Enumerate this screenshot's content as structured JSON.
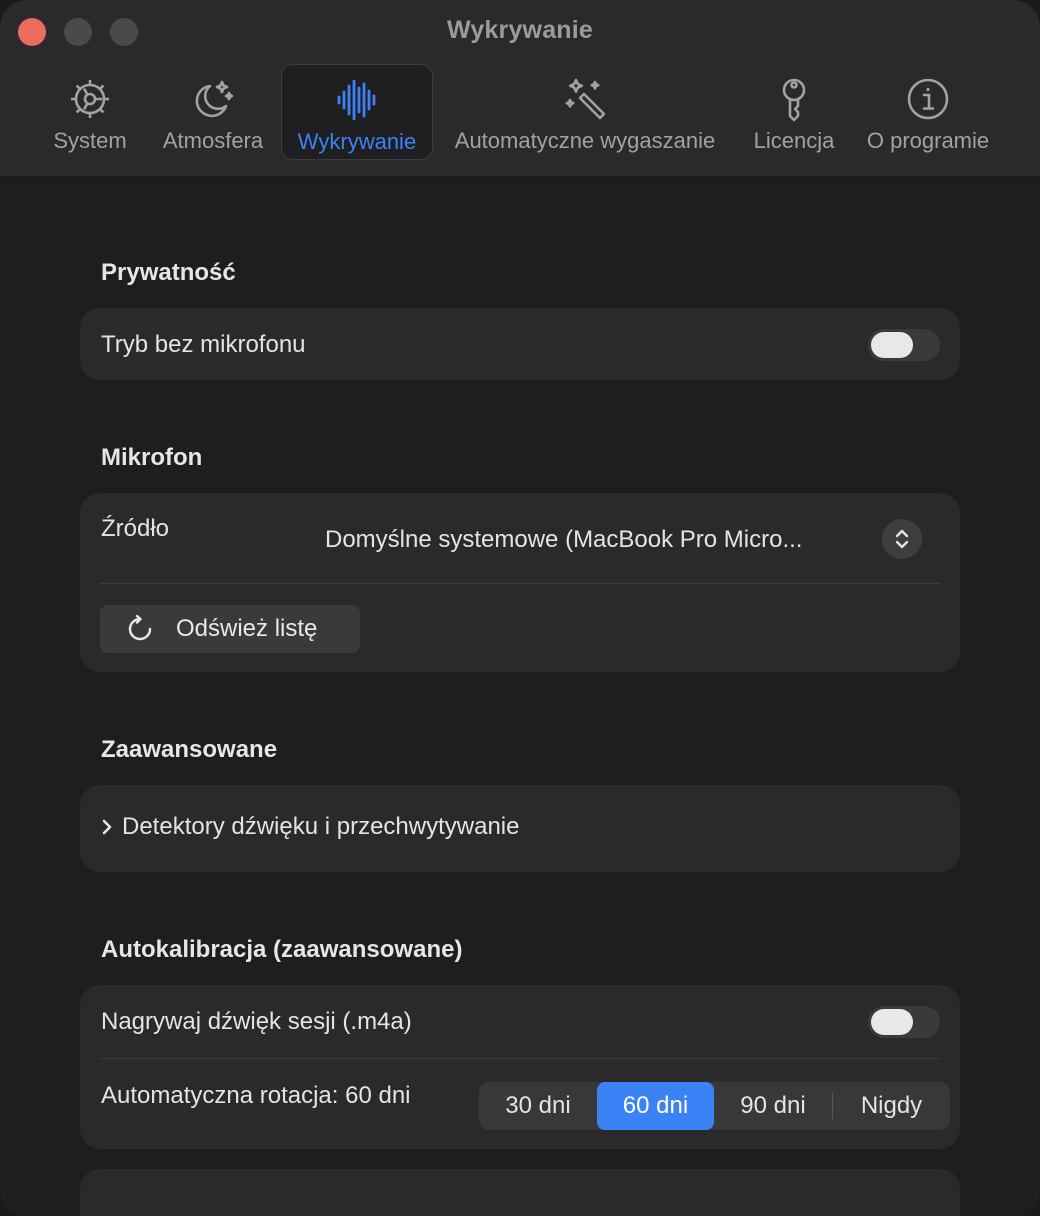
{
  "window": {
    "title": "Wykrywanie"
  },
  "tabs": [
    {
      "label": "System",
      "icon": "gear-icon"
    },
    {
      "label": "Atmosfera",
      "icon": "moon-stars-icon"
    },
    {
      "label": "Wykrywanie",
      "icon": "waveform-icon",
      "active": true
    },
    {
      "label": "Automatyczne wygaszanie",
      "icon": "magic-wand-icon"
    },
    {
      "label": "Licencja",
      "icon": "key-icon"
    },
    {
      "label": "O programie",
      "icon": "info-icon"
    }
  ],
  "privacy": {
    "title": "Prywatność",
    "no_mic_label": "Tryb bez mikrofonu",
    "no_mic_enabled": false
  },
  "microphone": {
    "title": "Mikrofon",
    "source_label": "Źródło",
    "source_value": "Domyślne systemowe (MacBook Pro Micro...",
    "refresh_label": "Odśwież listę"
  },
  "advanced": {
    "title": "Zaawansowane",
    "detectors_label": "Detektory dźwięku i przechwytywanie"
  },
  "autocal": {
    "title": "Autokalibracja (zaawansowane)",
    "record_label": "Nagrywaj dźwięk sesji (.m4a)",
    "record_enabled": false,
    "rotation_label": "Automatyczna rotacja: 60 dni",
    "rotation_options": [
      "30 dni",
      "60 dni",
      "90 dni",
      "Nigdy"
    ],
    "rotation_selected": "60 dni"
  },
  "colors": {
    "accent": "#3b82f6",
    "close": "#ed6a5e",
    "card": "#2a2a2c",
    "background": "#1e1e20"
  }
}
